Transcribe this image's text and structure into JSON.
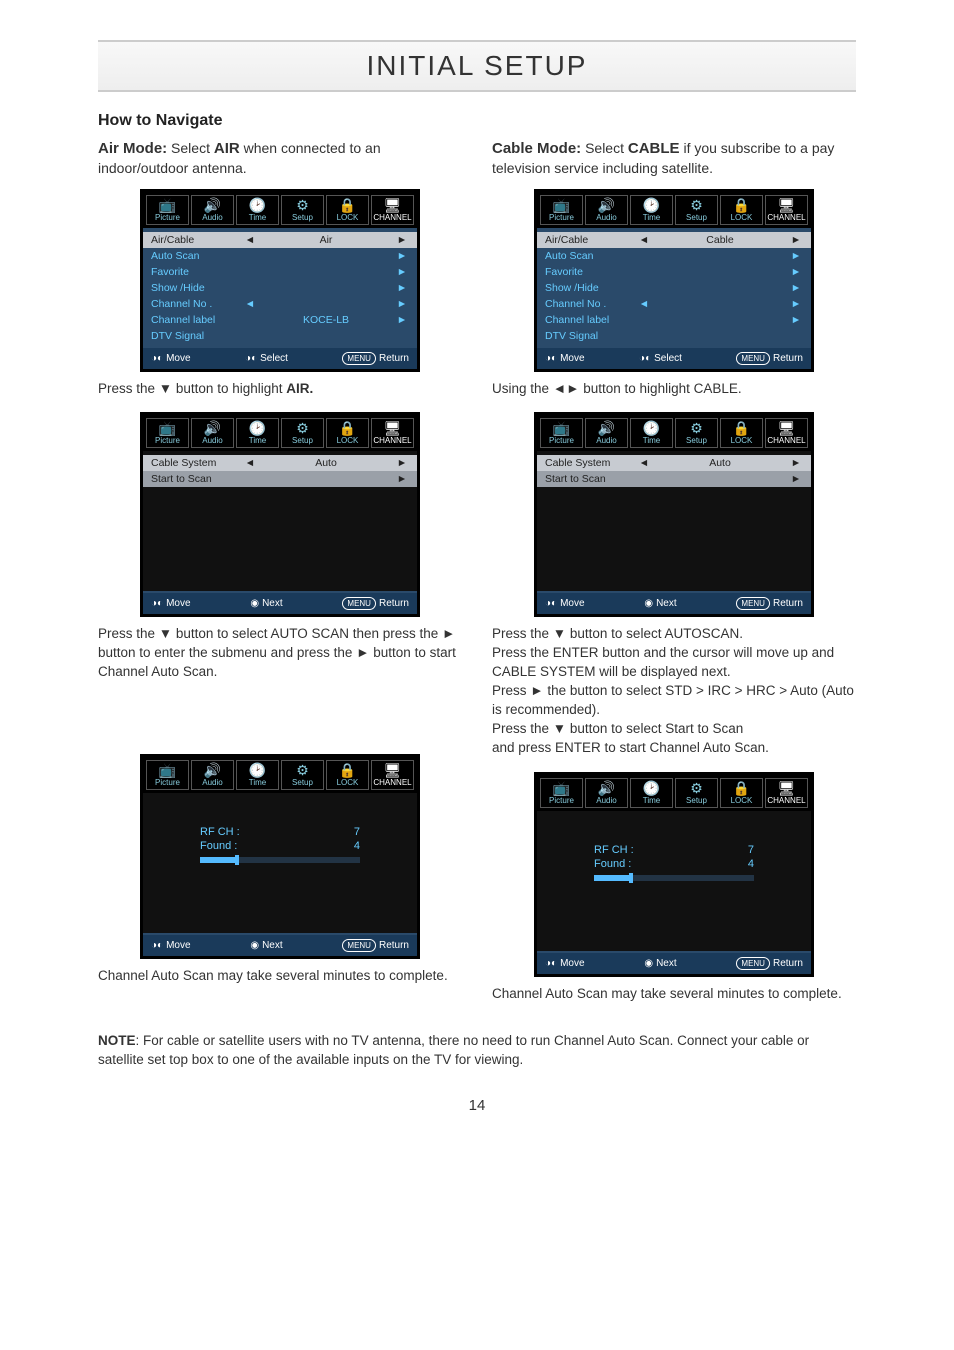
{
  "page": {
    "title": "INITIAL SETUP",
    "number": "14"
  },
  "nav_heading": "How to Navigate",
  "air": {
    "intro_label": "Air Mode:",
    "intro_text": " Select ",
    "intro_bold": "AIR",
    "intro_tail": " when connected to an indoor/outdoor antenna.",
    "cap1_pre": "Press the ",
    "cap1_mid": " button to highlight ",
    "cap1_bold": "AIR.",
    "cap2": "Press the ▼ button to select AUTO SCAN then press the ► button to enter the submenu and press the ► button to start Channel Auto Scan.",
    "cap3": "Channel Auto Scan may take several minutes to complete."
  },
  "cable": {
    "intro_label": "Cable Mode:",
    "intro_text": " Select ",
    "intro_bold": "CABLE",
    "intro_tail": " if you subscribe to a pay television service including satellite.",
    "cap1": "Using the ◄► button to highlight CABLE.",
    "cap2": "Press the ▼ button to select AUTOSCAN.\nPress the ENTER button and the cursor will move up and CABLE SYSTEM will be displayed next.\nPress ► the button to select STD > IRC > HRC > Auto (Auto is recommended).\nPress the ▼ button to select Start to Scan\nand press ENTER to start Channel Auto Scan.",
    "cap3": "Channel Auto Scan may take several minutes to complete."
  },
  "note": {
    "label": "NOTE",
    "text": ": For cable or satellite users with no TV antenna, there no need to run Channel Auto Scan. Connect your cable or satellite set top box to one of the available inputs on the TV for viewing."
  },
  "tabs": [
    "Picture",
    "Audio",
    "Time",
    "Setup",
    "LOCK",
    "CHANNEL"
  ],
  "tab_icons": [
    "📺",
    "🔊",
    "🕑",
    "⚙",
    "🔒",
    "🖥"
  ],
  "menuA_air": {
    "rows": [
      {
        "lbl": "Air/Cable",
        "sel": true,
        "arL": "◄",
        "val": "Air",
        "arR": "►"
      },
      {
        "lbl": "Auto Scan",
        "arR": "►"
      },
      {
        "lbl": "Favorite",
        "arR": "►"
      },
      {
        "lbl": "Show /Hide",
        "arR": "►"
      },
      {
        "lbl": "Channel No .",
        "arL": "◄",
        "arR": "►"
      },
      {
        "lbl": "Channel label",
        "val": "KOCE-LB",
        "arR": "►"
      },
      {
        "lbl": "DTV Signal"
      }
    ]
  },
  "menuA_cable": {
    "rows": [
      {
        "lbl": "Air/Cable",
        "sel": true,
        "arL": "◄",
        "val": "Cable",
        "arR": "►"
      },
      {
        "lbl": "Auto Scan",
        "arR": "►"
      },
      {
        "lbl": "Favorite",
        "arR": "►"
      },
      {
        "lbl": "Show /Hide",
        "arR": "►"
      },
      {
        "lbl": "Channel No .",
        "arL": "◄",
        "arR": "►"
      },
      {
        "lbl": "Channel label",
        "arR": "►"
      },
      {
        "lbl": "DTV Signal"
      }
    ]
  },
  "menuB": {
    "rows": [
      {
        "lbl": "Cable System",
        "sel": true,
        "arL": "◄",
        "val": "Auto",
        "arR": "►"
      },
      {
        "lbl": "Start to Scan",
        "sel2": true,
        "arR": "►"
      }
    ]
  },
  "scan": {
    "rf_lbl": "RF CH :",
    "rf_val": "7",
    "found_lbl": "Found :",
    "found_val": "4"
  },
  "footA": {
    "move": "Move",
    "select": "Select",
    "menu": "MENU",
    "ret": "Return"
  },
  "footB": {
    "move": "Move",
    "next": "Next",
    "menu": "MENU",
    "ret": "Return"
  }
}
